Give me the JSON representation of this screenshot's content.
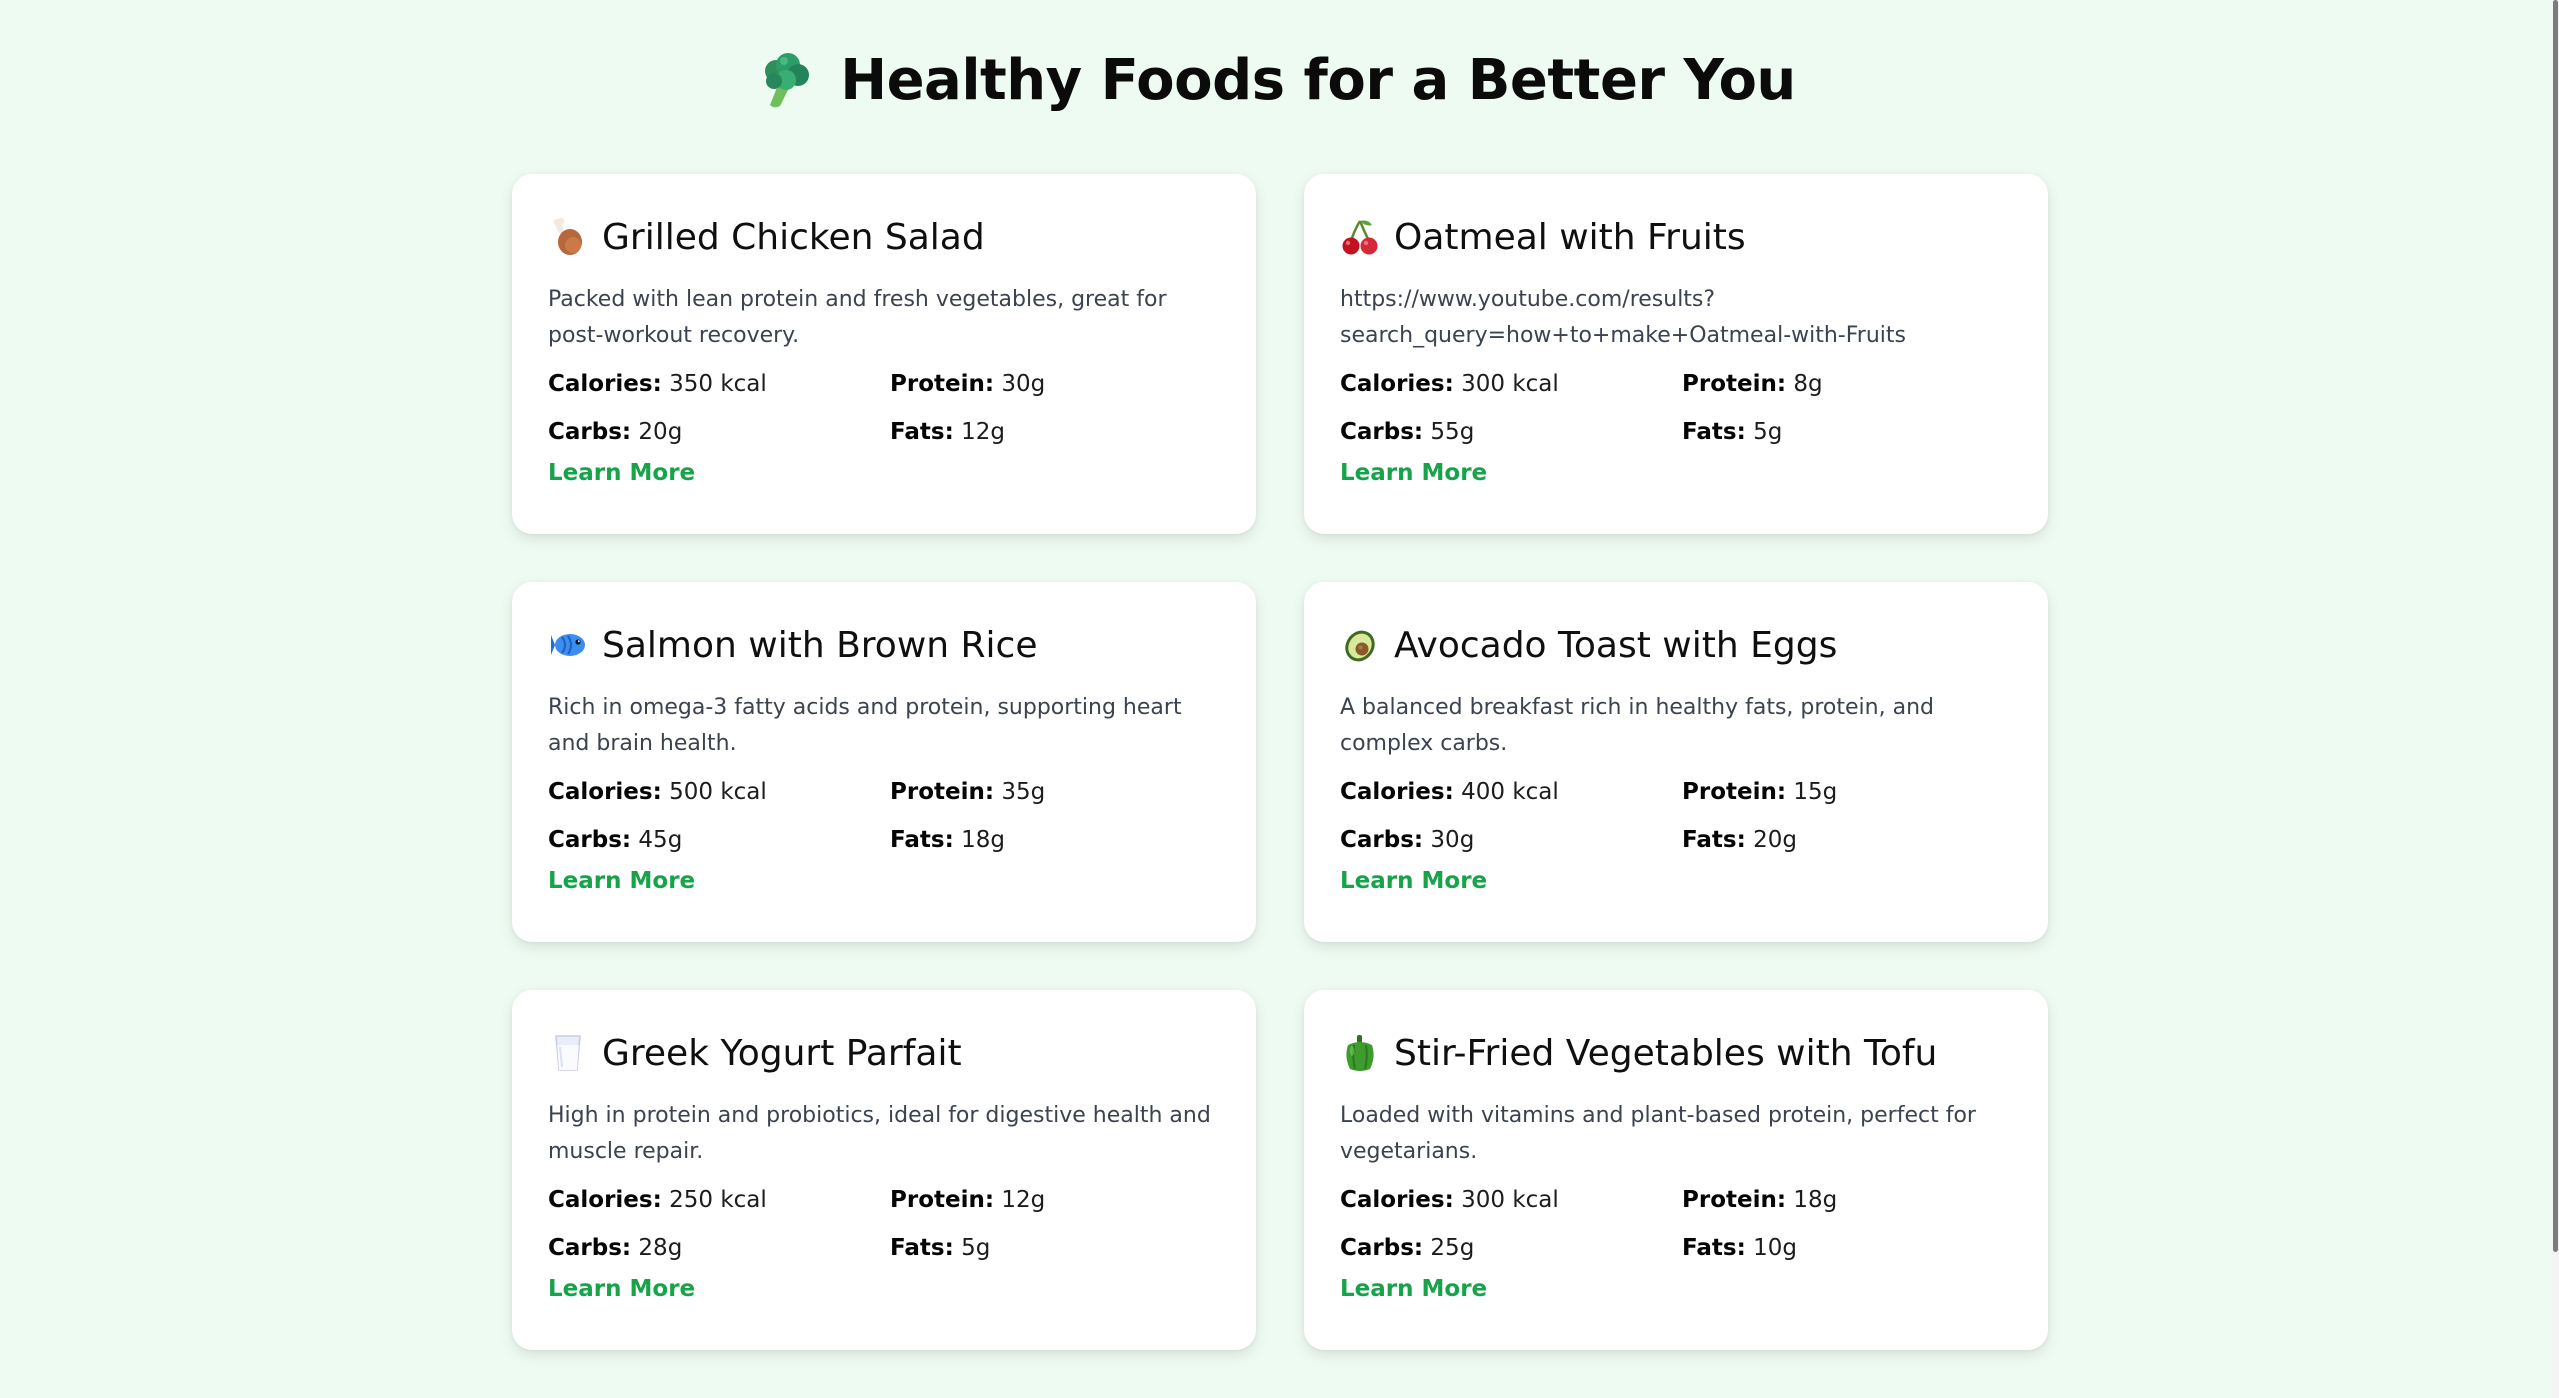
{
  "header": {
    "emoji_icon": "broccoli-icon",
    "title": "Healthy Foods for a Better You"
  },
  "labels": {
    "calories": "Calories:",
    "protein": "Protein:",
    "carbs": "Carbs:",
    "fats": "Fats:"
  },
  "cards": [
    {
      "icon": "chicken-leg-icon",
      "title": "Grilled Chicken Salad",
      "description": "Packed with lean protein and fresh vegetables, great for post-workout recovery.",
      "calories": "350 kcal",
      "protein": "30g",
      "carbs": "20g",
      "fats": "12g",
      "link": "Learn More"
    },
    {
      "icon": "cherries-icon",
      "title": "Oatmeal with Fruits",
      "description": "https://www.youtube.com/results?search_query=how+to+make+Oatmeal-with-Fruits",
      "calories": "300 kcal",
      "protein": "8g",
      "carbs": "55g",
      "fats": "5g",
      "link": "Learn More"
    },
    {
      "icon": "fish-icon",
      "title": "Salmon with Brown Rice",
      "description": "Rich in omega-3 fatty acids and protein, supporting heart and brain health.",
      "calories": "500 kcal",
      "protein": "35g",
      "carbs": "45g",
      "fats": "18g",
      "link": "Learn More"
    },
    {
      "icon": "avocado-icon",
      "title": "Avocado Toast with Eggs",
      "description": "A balanced breakfast rich in healthy fats, protein, and complex carbs.",
      "calories": "400 kcal",
      "protein": "15g",
      "carbs": "30g",
      "fats": "20g",
      "link": "Learn More"
    },
    {
      "icon": "glass-of-milk-icon",
      "title": "Greek Yogurt Parfait",
      "description": "High in protein and probiotics, ideal for digestive health and muscle repair.",
      "calories": "250 kcal",
      "protein": "12g",
      "carbs": "28g",
      "fats": "5g",
      "link": "Learn More"
    },
    {
      "icon": "bell-pepper-icon",
      "title": "Stir-Fried Vegetables with Tofu",
      "description": "Loaded with vitamins and plant-based protein, perfect for vegetarians.",
      "calories": "300 kcal",
      "protein": "18g",
      "carbs": "25g",
      "fats": "10g",
      "link": "Learn More"
    }
  ],
  "colors": {
    "background": "#eefbf2",
    "card": "#ffffff",
    "accent_link": "#16a34a",
    "description_text": "#3b4350"
  }
}
